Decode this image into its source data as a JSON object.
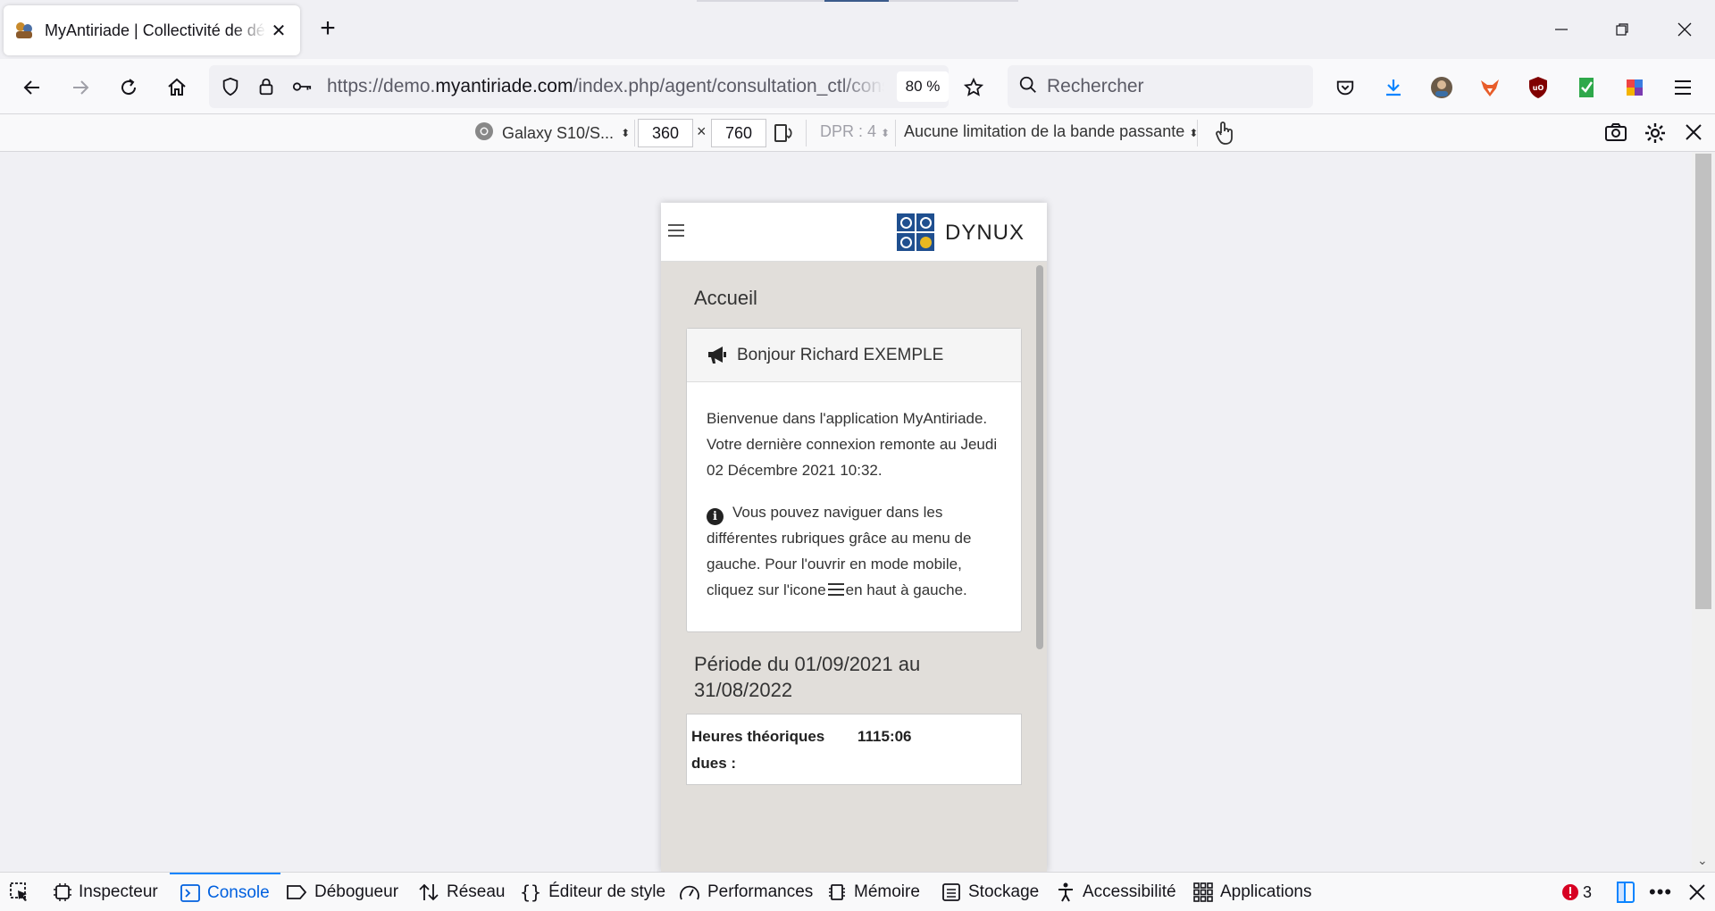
{
  "browser": {
    "tab_title": "MyAntiriade | Collectivité de démonstration",
    "url_prefix": "https://demo.",
    "url_domain": "myantiriade.com",
    "url_path": "/index.php/agent/consultation_ctl/consultation",
    "zoom": "80 %",
    "search_placeholder": "Rechercher"
  },
  "rdm": {
    "device": "Galaxy S10/S...",
    "width": "360",
    "times": "×",
    "height": "760",
    "dpr": "DPR : 4",
    "throttling": "Aucune limitation de la bande passante"
  },
  "page": {
    "brand": "DYNUX",
    "title": "Accueil",
    "card_title": "Bonjour Richard EXEMPLE",
    "welcome": "Bienvenue dans l'application MyAntiriade. Votre dernière connexion remonte au Jeudi 02 Décembre 2021 10:32.",
    "info_text_1": "Vous pouvez naviguer dans les différentes rubriques grâce au menu de gauche. Pour l'ouvrir en mode mobile, cliquez sur l'icone",
    "info_text_2": "en haut à gauche.",
    "period_title": "Période du 01/09/2021 au 31/08/2022",
    "hours_label": "Heures théoriques dues :",
    "hours_value": "1115:06"
  },
  "devtools": {
    "tabs": [
      "Inspecteur",
      "Console",
      "Débogueur",
      "Réseau",
      "Éditeur de style",
      "Performances",
      "Mémoire",
      "Stockage",
      "Accessibilité",
      "Applications"
    ],
    "active_tab": "Console",
    "error_count": "3"
  },
  "colors": {
    "accent": "#0a84ff",
    "logo_blue": "#1f4f8f",
    "logo_gold": "#e8b820",
    "page_bg": "#e1deda"
  }
}
